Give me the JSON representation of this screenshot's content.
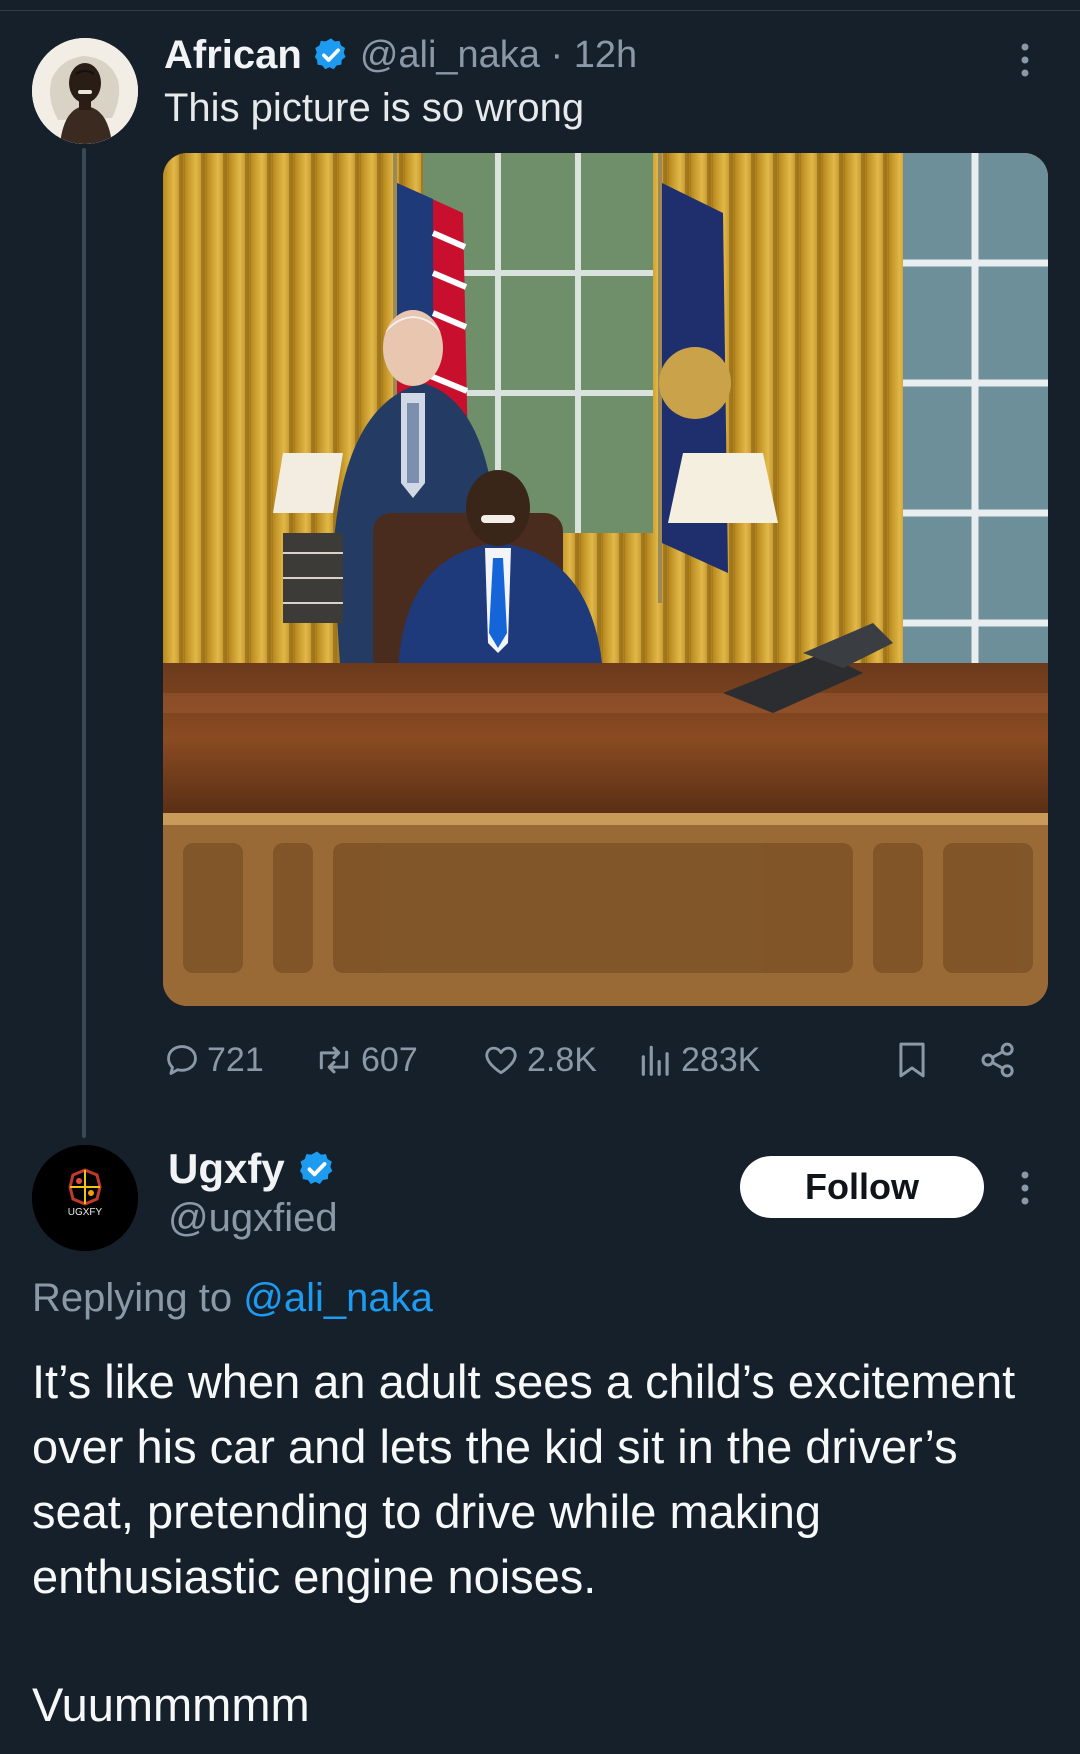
{
  "tweet": {
    "author_name": "African",
    "author_handle": "@ali_naka",
    "separator": "·",
    "time": "12h",
    "text": "This picture is so wrong",
    "stats": {
      "replies": "721",
      "reposts": "607",
      "likes": "2.8K",
      "views": "283K"
    }
  },
  "reply": {
    "author_name": "Ugxfy",
    "author_handle": "@ugxfied",
    "avatar_text": "UGXFY",
    "follow_label": "Follow",
    "replying_prefix": "Replying to",
    "replying_to": "@ali_naka",
    "text": "It’s like when an adult sees a child’s excitement over his car and lets the kid sit in the driver’s seat, pretending to drive while making enthusiastic engine noises.",
    "text2": "Vuummmmm"
  },
  "colors": {
    "background": "#15202b",
    "verified": "#1d9bf0",
    "secondary_text": "#8b98a5",
    "follow_bg": "#ffffff"
  }
}
